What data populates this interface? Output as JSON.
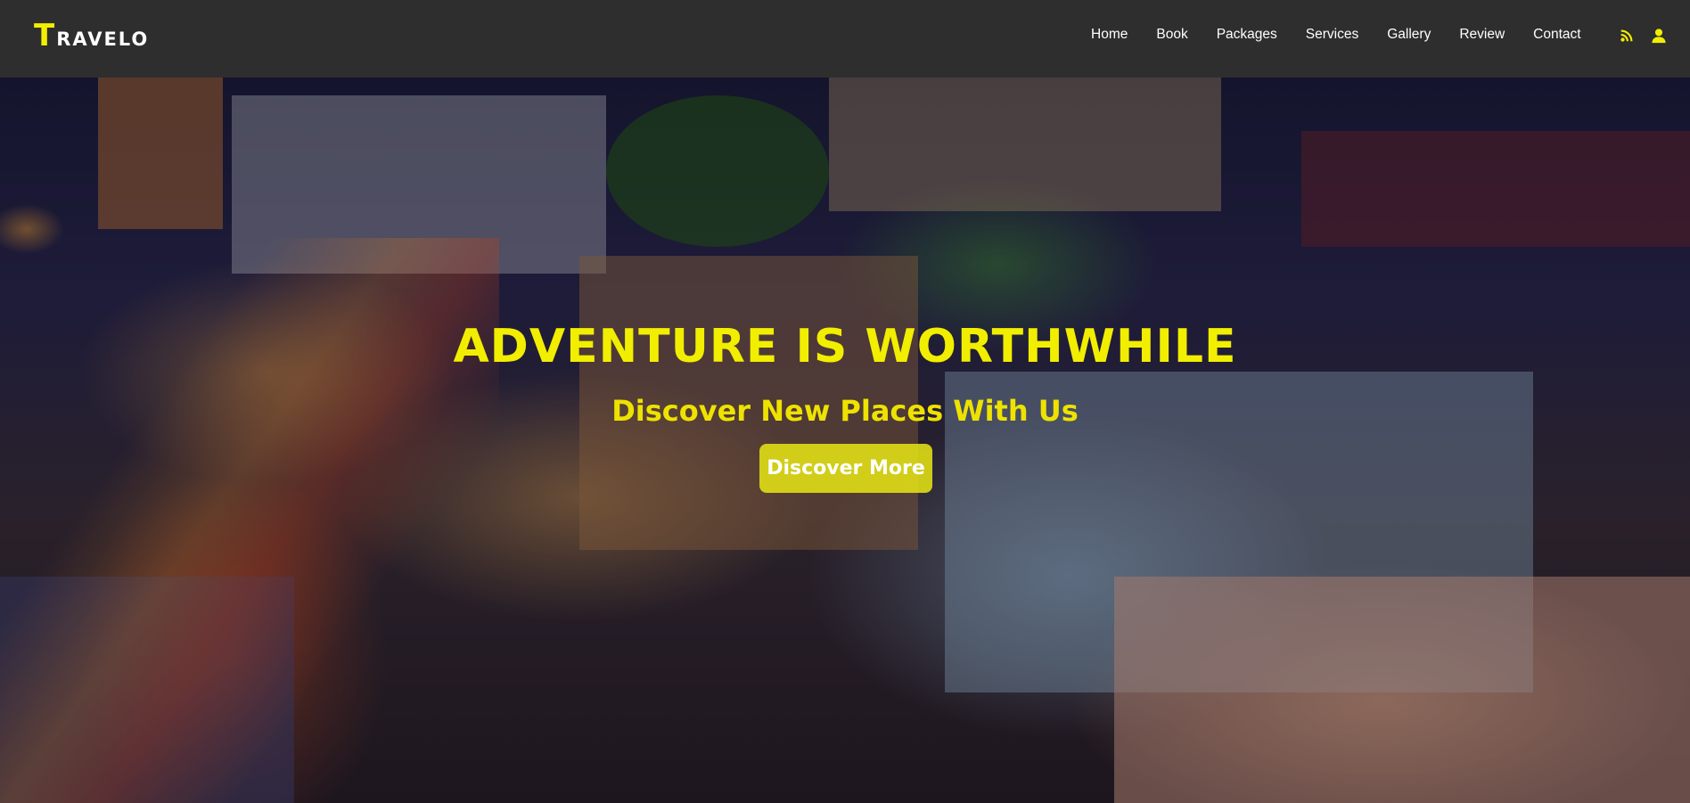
{
  "brand": {
    "first_letter": "T",
    "rest": "ravelo",
    "accent_color": "#f2ee00"
  },
  "nav": {
    "items": [
      {
        "label": "Home"
      },
      {
        "label": "Book"
      },
      {
        "label": "Packages"
      },
      {
        "label": "Services"
      },
      {
        "label": "Gallery"
      },
      {
        "label": "Review"
      },
      {
        "label": "Contact"
      }
    ],
    "icons": [
      "rss-icon",
      "user-icon"
    ]
  },
  "hero": {
    "headline": "ADVENTURE IS WORTHWHILE",
    "subheadline": "Discover New Places With Us",
    "cta_label": "Discover More",
    "background": "night city street photo"
  }
}
